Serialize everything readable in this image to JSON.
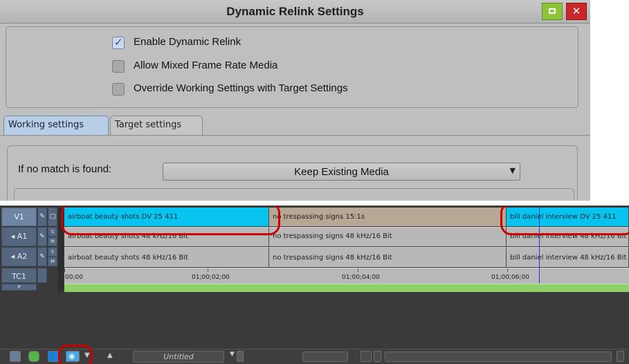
{
  "dialog": {
    "title": "Dynamic Relink Settings",
    "maximize_icon": "maximize-icon",
    "close_icon": "close-icon",
    "close_glyph": "✕",
    "options": [
      {
        "label": "Enable Dynamic Relink",
        "checked": true
      },
      {
        "label": "Allow Mixed Frame Rate Media",
        "checked": false
      },
      {
        "label": "Override Working Settings with Target Settings",
        "checked": false
      }
    ],
    "tabs": [
      {
        "label": "Working settings",
        "active": true
      },
      {
        "label": "Target settings",
        "active": false
      }
    ],
    "no_match_label": "If no match is found:",
    "no_match_value": "Keep Existing Media"
  },
  "timeline": {
    "tracks": {
      "v1": "V1",
      "a1": "◂ A1",
      "a2": "◂ A2",
      "tc1": "TC1",
      "p": "P",
      "solo": "S",
      "mute": "M"
    },
    "video_clips": [
      {
        "name": "airboat beauty shots  DV 25 411"
      },
      {
        "name": "no trespassing signs  15:1s"
      },
      {
        "name": "bill daniel interview  DV 25 411"
      }
    ],
    "a1_clips": [
      {
        "name": "airboat beauty shots  48 kHz/16 Bit"
      },
      {
        "name": "no trespassing signs  48 kHz/16 Bit"
      },
      {
        "name": "bill daniel interview  48 kHz/16 Bit"
      }
    ],
    "a2_clips": [
      {
        "name": "airboat beauty shots  48 kHz/16 Bit"
      },
      {
        "name": "no trespassing signs  48 kHz/16 Bit"
      },
      {
        "name": "bill daniel interview  48 kHz/16 Bit"
      }
    ],
    "ruler": [
      "00;00",
      "01;00;02;00",
      "01;00;04;00",
      "01;00;06;00"
    ],
    "sequence_name": "Untitled",
    "colors": {
      "video_clip": "#09c3ef",
      "audio_clip": "#b8b8b8",
      "highlight": "#cc0000",
      "playhead": "#2d2ed9"
    }
  }
}
